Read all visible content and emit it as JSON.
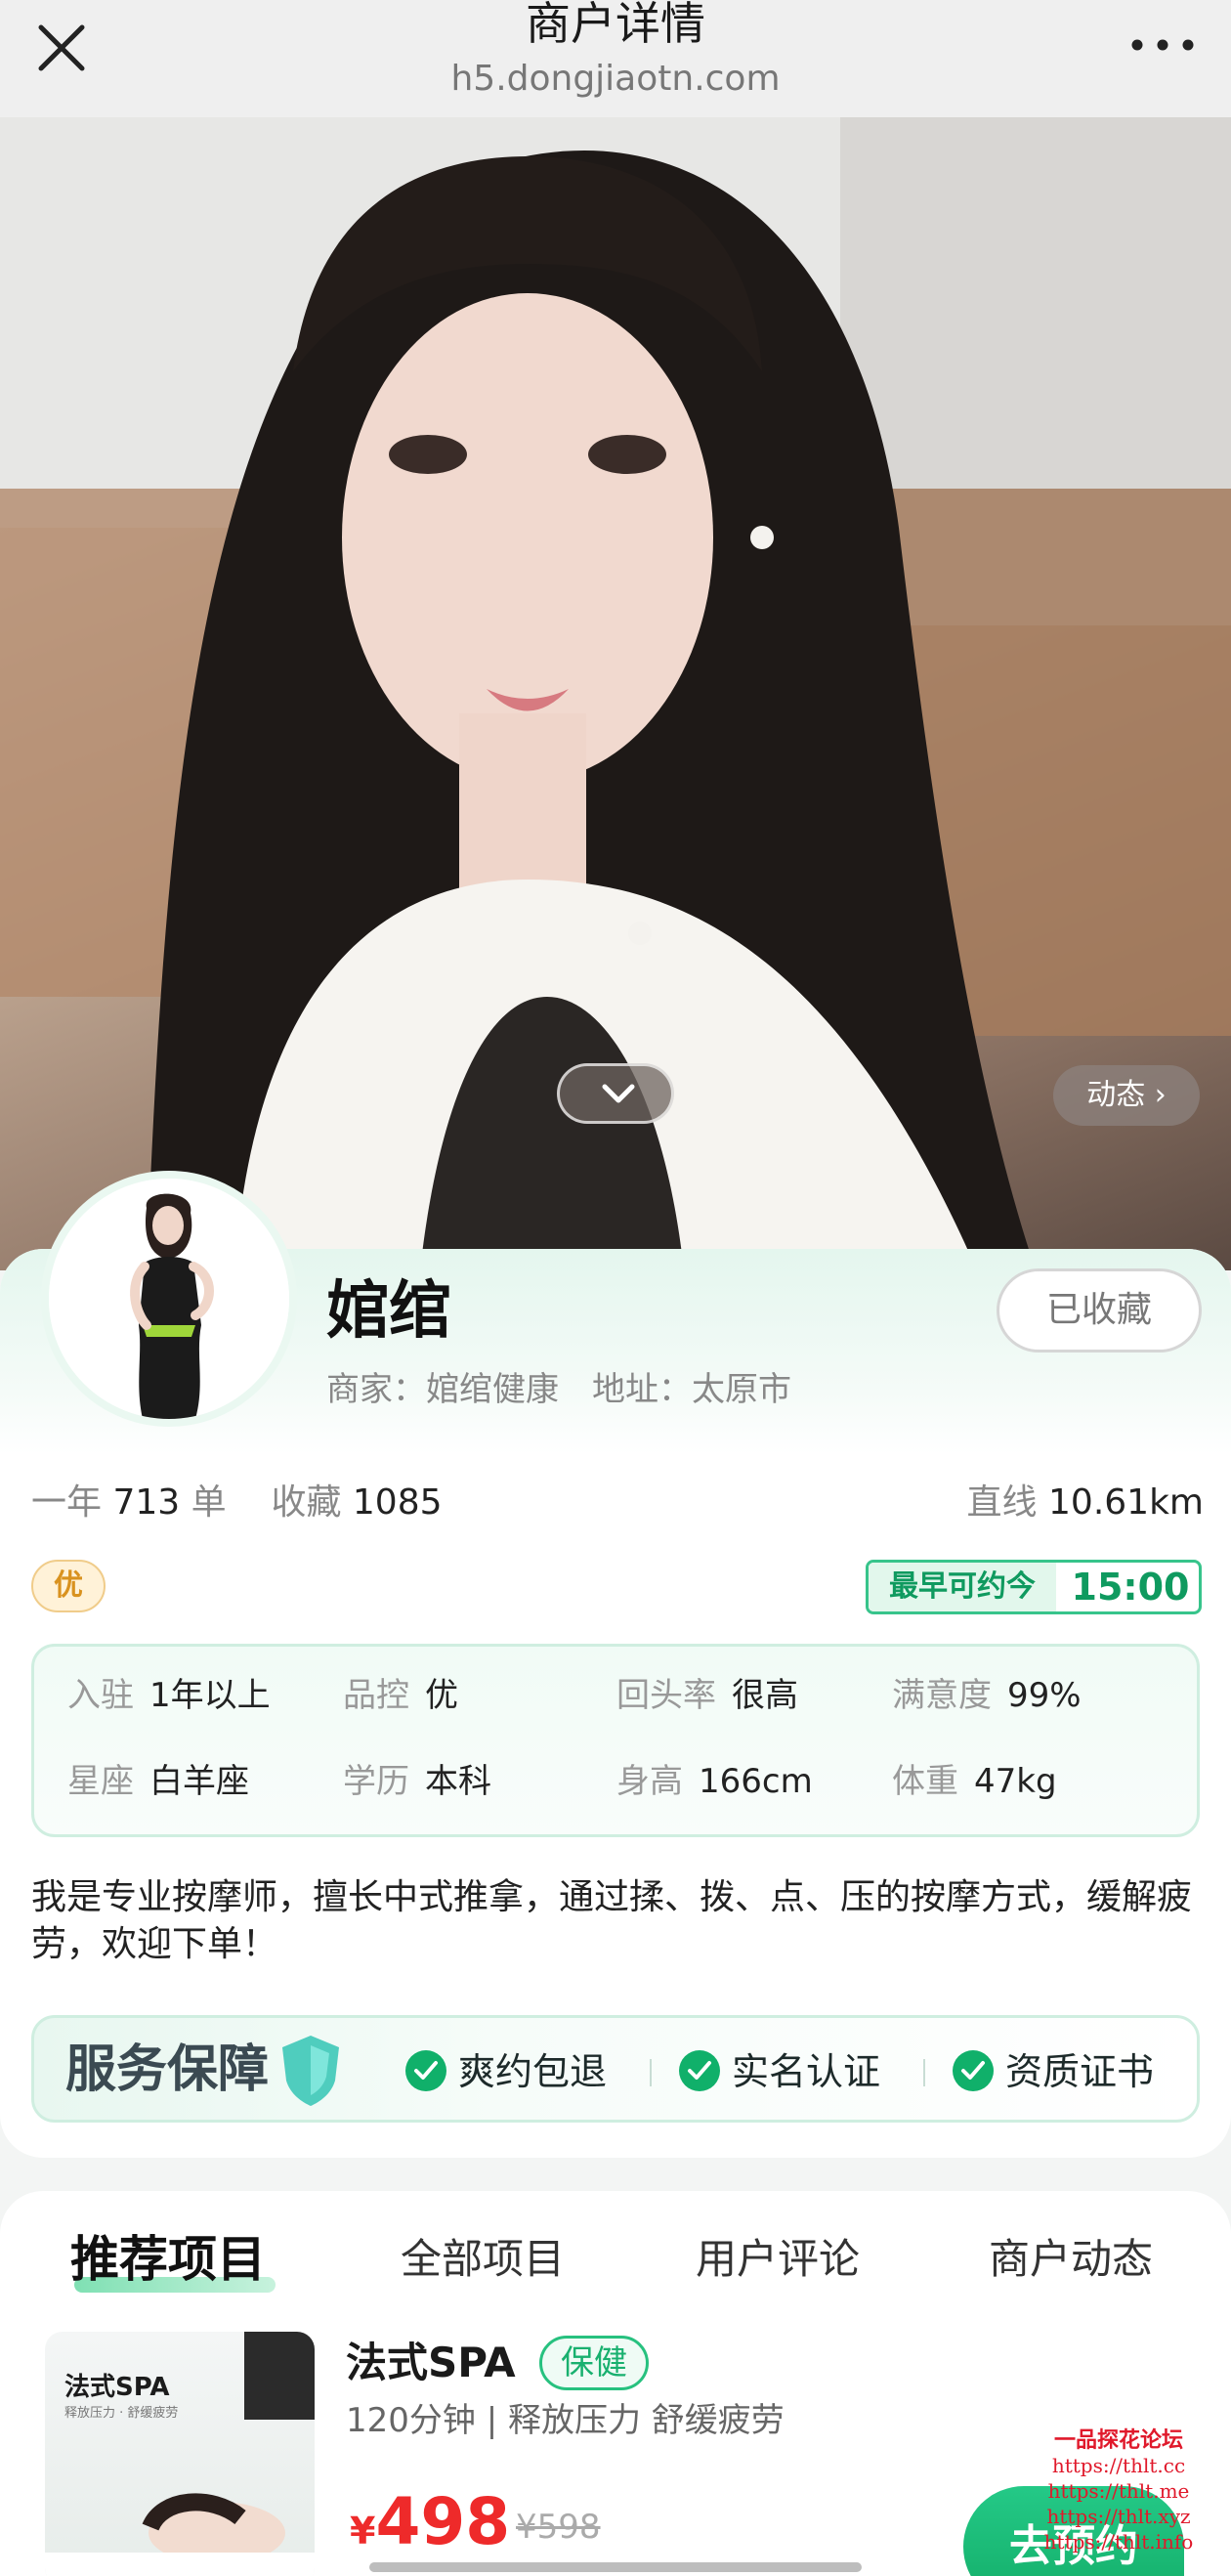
{
  "nav": {
    "title": "商户详情",
    "url": "h5.dongjiaotn.com",
    "close_icon": "close-icon",
    "more_icon": "more-icon"
  },
  "hero": {
    "dynamic_label": "动态 ›"
  },
  "profile": {
    "name": "婠绾",
    "fav_label": "已收藏",
    "merchant_label": "商家：",
    "merchant_value": "婠绾健康",
    "address_label": "地址：",
    "address_value": "太原市"
  },
  "stats": {
    "year_label": "一年",
    "orders": "713",
    "orders_unit": "单",
    "fav_label": "收藏",
    "favs": "1085",
    "distance_label": "直线",
    "distance": "10.61km"
  },
  "badge": "优",
  "earliest": {
    "label": "最早可约今",
    "time": "15:00"
  },
  "info": [
    {
      "k": "入驻",
      "v": "1年以上"
    },
    {
      "k": "品控",
      "v": "优"
    },
    {
      "k": "回头率",
      "v": "很高"
    },
    {
      "k": "满意度",
      "v": "99%"
    },
    {
      "k": "星座",
      "v": "白羊座"
    },
    {
      "k": "学历",
      "v": "本科"
    },
    {
      "k": "身高",
      "v": "166cm"
    },
    {
      "k": "体重",
      "v": "47kg"
    }
  ],
  "bio": "我是专业按摩师，擅长中式推拿，通过揉、拨、点、压的按摩方式，缓解疲劳，欢迎下单！",
  "guarantee": {
    "title": "服务保障",
    "items": [
      "爽约包退",
      "实名认证",
      "资质证书"
    ]
  },
  "tabs": [
    "推荐项目",
    "全部项目",
    "用户评论",
    "商户动态"
  ],
  "project": {
    "thumb_title": "法式SPA",
    "thumb_sub": "释放压力 · 舒缓疲劳",
    "title": "法式SPA",
    "tag": "保健",
    "desc": "120分钟 | 释放压力 舒缓疲劳",
    "currency": "¥",
    "price": "498",
    "orig_price": "¥598",
    "book_label": "去预约"
  },
  "watermark": [
    "一品探花论坛",
    "https://thlt.cc",
    "https://thlt.me",
    "https://thlt.xyz",
    "https://thlt.info"
  ],
  "colors": {
    "accent": "#13ad68",
    "price": "#ee2a2a",
    "badge": "#d9921f"
  }
}
